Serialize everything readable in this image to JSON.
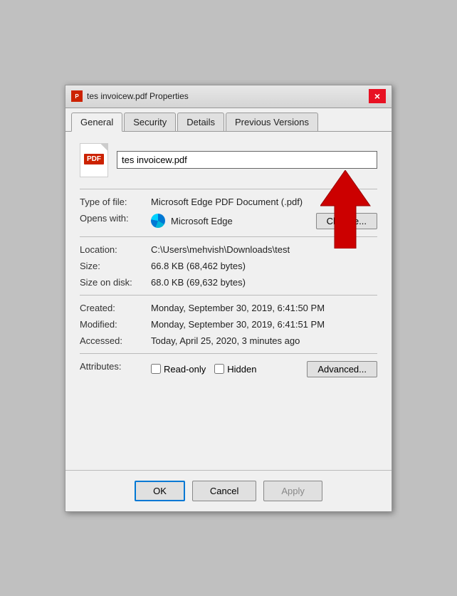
{
  "titleBar": {
    "title": "tes invoicew.pdf Properties",
    "closeLabel": "×"
  },
  "tabs": [
    {
      "label": "General",
      "active": true
    },
    {
      "label": "Security",
      "active": false
    },
    {
      "label": "Details",
      "active": false
    },
    {
      "label": "Previous Versions",
      "active": false
    }
  ],
  "fileNameInput": {
    "value": "tes invoicew.pdf"
  },
  "properties": {
    "typeLabel": "Type of file:",
    "typeValue": "Microsoft Edge PDF Document (.pdf)",
    "opensLabel": "Opens with:",
    "opensApp": "Microsoft Edge",
    "changeBtn": "Change...",
    "locationLabel": "Location:",
    "locationValue": "C:\\Users\\mehvish\\Downloads\\test",
    "sizeLabel": "Size:",
    "sizeValue": "66.8 KB (68,462 bytes)",
    "sizeOnDiskLabel": "Size on disk:",
    "sizeOnDiskValue": "68.0 KB (69,632 bytes)",
    "createdLabel": "Created:",
    "createdValue": "Monday, September 30, 2019, 6:41:50 PM",
    "modifiedLabel": "Modified:",
    "modifiedValue": "Monday, September 30, 2019, 6:41:51 PM",
    "accessedLabel": "Accessed:",
    "accessedValue": "Today, April 25, 2020, 3 minutes ago",
    "attributesLabel": "Attributes:",
    "readonlyLabel": "Read-only",
    "hiddenLabel": "Hidden",
    "advancedBtn": "Advanced..."
  },
  "footer": {
    "okLabel": "OK",
    "cancelLabel": "Cancel",
    "applyLabel": "Apply"
  }
}
